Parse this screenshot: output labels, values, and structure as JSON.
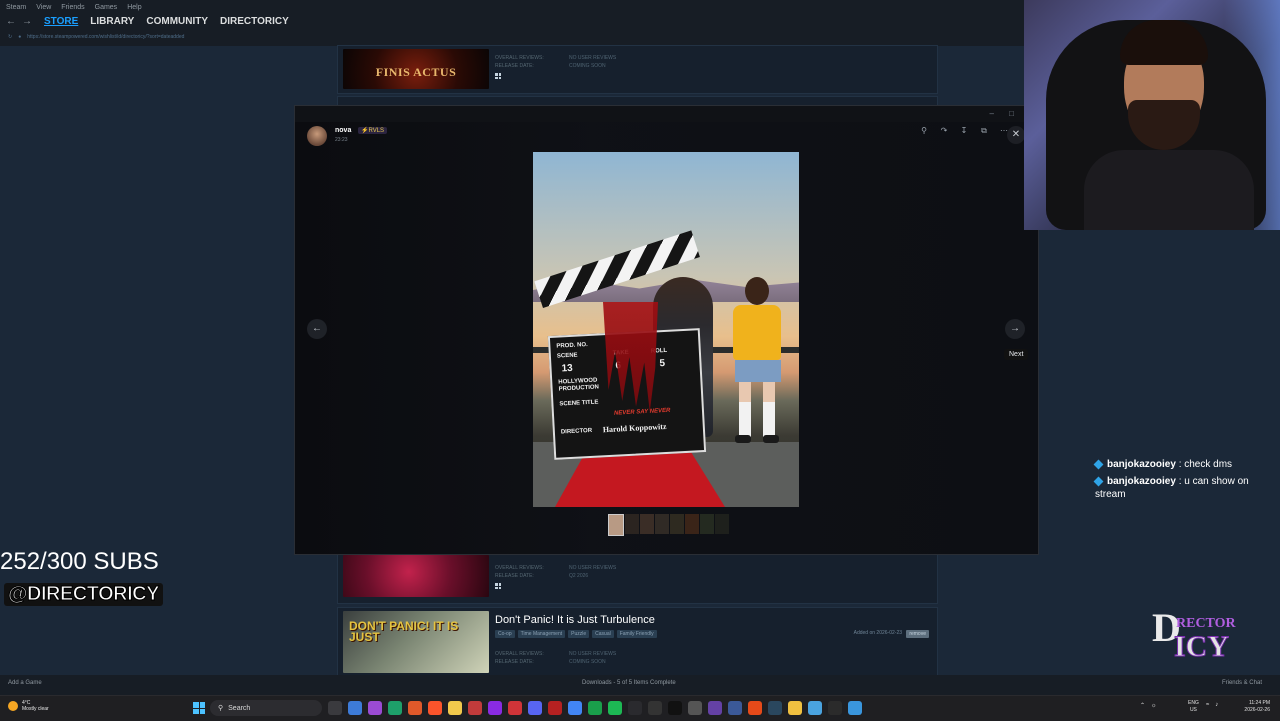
{
  "steam": {
    "menu": [
      "Steam",
      "View",
      "Friends",
      "Games",
      "Help"
    ],
    "nav_back": "←",
    "nav_forward": "→",
    "tabs": [
      "STORE",
      "LIBRARY",
      "COMMUNITY",
      "DIRECTORICY"
    ],
    "active_tab": "STORE",
    "url": "https://store.steampowered.com/wishlist/id/directoricy/?sort=dateadded",
    "add_game": "Add a Game",
    "downloads": "Downloads - 5 of 5 Items Complete",
    "friends_chat": "Friends & Chat"
  },
  "wishlist": {
    "row1": {
      "thumb_text": "FINIS ACTUS",
      "overall_label": "OVERALL REVIEWS:",
      "overall_value": "NO USER REVIEWS",
      "release_label": "RELEASE DATE:",
      "release_value": "COMING SOON"
    },
    "row2": {
      "overall_label": "OVERALL REVIEWS:",
      "overall_value": "NO USER REVIEWS",
      "release_label": "RELEASE DATE:",
      "release_value": "Q2 2026"
    },
    "row3": {
      "title": "Don't Panic! It is Just Turbulence",
      "thumb_text": "DON'T PANIC! IT IS JUST",
      "tags": [
        "Co-op",
        "Time Management",
        "Puzzle",
        "Casual",
        "Family Friendly"
      ],
      "added": "Added on 2026-02-23",
      "remove_label": "remove",
      "overall_label": "OVERALL REVIEWS:",
      "overall_value": "NO USER REVIEWS",
      "release_label": "RELEASE DATE:",
      "release_value": "COMING SOON"
    }
  },
  "viewer": {
    "username": "nova",
    "badge": "⚡RVLS",
    "time": "23:23",
    "tools": [
      "zoom-icon",
      "forward-icon",
      "download-icon",
      "open-external-icon",
      "more-icon"
    ],
    "close_glyph": "✕",
    "prev_glyph": "←",
    "next_glyph": "→",
    "next_tooltip": "Next",
    "minimize_glyph": "–",
    "maximize_glyph": "□",
    "photo": {
      "board_prod": "PROD. NO.",
      "board_scene": "SCENE",
      "board_scene_num": "13",
      "board_take": "TAKE",
      "board_roll": "ROLL",
      "board_take_num": "6",
      "board_roll_num": "5",
      "board_prod_co": "HOLLYWOOD PRODUCTION",
      "board_scene_title": "SCENE TITLE",
      "board_director": "DIRECTOR",
      "board_director_name": "Harold Koppowitz",
      "board_never": "NEVER SAY NEVER"
    }
  },
  "stream": {
    "subs": "252/300 SUBS",
    "handle": "@DIRECTORICY",
    "logo_d": "D",
    "logo_rector": "RECTOR",
    "logo_icy": "ICY",
    "chat": [
      {
        "user": "banjokazooiey",
        "message": ": check dms"
      },
      {
        "user": "banjokazooiey",
        "message": ": u can show on stream"
      }
    ]
  },
  "taskbar": {
    "temperature": "4°C",
    "weather": "Mostly clear",
    "search_placeholder": "Search",
    "lang_1": "ENG",
    "lang_2": "US",
    "time": "11:24 PM",
    "date": "2026-02-26"
  },
  "colors": {
    "steam_bg": "#1b2838",
    "steam_accent": "#1a9fff",
    "chat_dot": "#2fa4e7"
  }
}
